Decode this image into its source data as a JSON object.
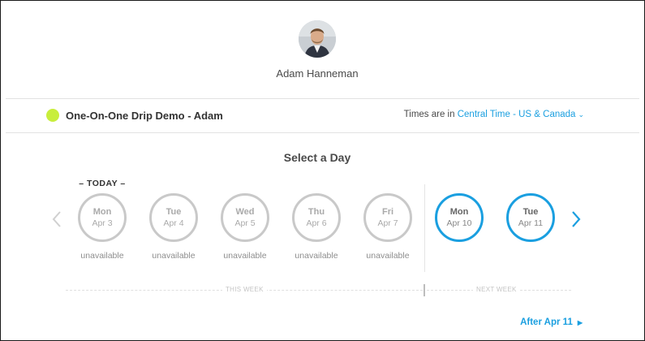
{
  "host": {
    "name": "Adam Hanneman"
  },
  "event": {
    "title": "One-On-One Drip Demo - Adam",
    "dot_color": "#c8ee3c",
    "timezone_prefix": "Times are in",
    "timezone_value": "Central Time - US & Canada"
  },
  "calendar": {
    "heading": "Select a Day",
    "today_label": "– TODAY –",
    "days": [
      {
        "name": "Mon",
        "date": "Apr 3",
        "status": "unavailable",
        "available": false
      },
      {
        "name": "Tue",
        "date": "Apr 4",
        "status": "unavailable",
        "available": false
      },
      {
        "name": "Wed",
        "date": "Apr 5",
        "status": "unavailable",
        "available": false
      },
      {
        "name": "Thu",
        "date": "Apr 6",
        "status": "unavailable",
        "available": false
      },
      {
        "name": "Fri",
        "date": "Apr 7",
        "status": "unavailable",
        "available": false
      },
      {
        "name": "Mon",
        "date": "Apr 10",
        "status": "",
        "available": true
      },
      {
        "name": "Tue",
        "date": "Apr 11",
        "status": "",
        "available": true
      }
    ],
    "this_week_label": "THIS WEEK",
    "next_week_label": "NEXT WEEK",
    "after_label": "After Apr 11"
  },
  "icons": {
    "prev": "chevron-left-icon",
    "next": "chevron-right-icon",
    "timezone_dropdown": "chevron-down-icon",
    "after": "caret-right-icon"
  },
  "colors": {
    "accent": "#1a9fe0",
    "unavailable_border": "#c9c9c9"
  }
}
